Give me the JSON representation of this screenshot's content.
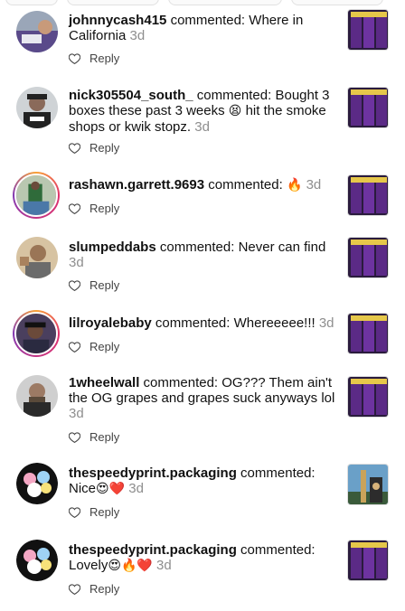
{
  "comments": [
    {
      "username": "johnnycash415",
      "verb": "commented:",
      "text": "Where in California",
      "time": "3d",
      "reply": "Reply"
    },
    {
      "username": "nick305504_south_",
      "verb": "commented:",
      "text": "Bought 3 boxes these past 3 weeks",
      "emoji1": "😫",
      "text2": "hit the smoke shops or kwik stopz.",
      "time": "3d",
      "reply": "Reply"
    },
    {
      "username": "rashawn.garrett.9693",
      "verb": "commented:",
      "emoji1": "🔥",
      "time": "3d",
      "reply": "Reply"
    },
    {
      "username": "slumpeddabs",
      "verb": "commented:",
      "text": "Never can find",
      "time": "3d",
      "reply": "Reply"
    },
    {
      "username": "lilroyalebaby",
      "verb": "commented:",
      "text": "Whereeeee!!!",
      "time": "3d",
      "reply": "Reply"
    },
    {
      "username": "1wheelwall",
      "verb": "commented:",
      "text": "OG??? Them ain't the OG grapes and grapes suck anyways lol",
      "time": "3d",
      "reply": "Reply"
    },
    {
      "username": "thespeedyprint.packaging",
      "verb": "commented:",
      "text": "Nice",
      "emoji1": "😍",
      "emoji2": "❤️",
      "time": "3d",
      "reply": "Reply"
    },
    {
      "username": "thespeedyprint.packaging",
      "verb": "commented:",
      "text": "Lovely",
      "emoji1": "😍",
      "emoji2": "🔥",
      "emoji3": "❤️",
      "time": "3d",
      "reply": "Reply"
    }
  ],
  "colors": {
    "text": "#111111",
    "meta": "#8e8e8e",
    "thumb_purple": "#5b2a86",
    "ring_start": "#f9a236",
    "ring_end": "#833ab4"
  }
}
